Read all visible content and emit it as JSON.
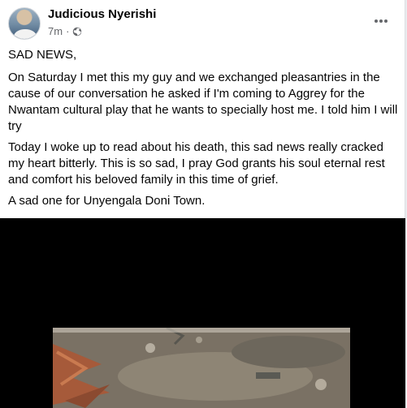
{
  "post": {
    "author": "Judicious Nyerishi",
    "time": "7m",
    "separator": "·",
    "paragraphs": [
      "SAD NEWS,",
      "On Saturday I met this my guy and we exchanged pleasantries in the cause of our conversation he asked if I'm coming to Aggrey for the Nwantam cultural play that he wants to specially host me. I told him I will try",
      "Today I woke up to read about his death, this sad news really cracked my heart bitterly. This is so sad, I pray God grants his soul eternal rest and comfort his beloved family in this time of grief.",
      "A sad one for Unyengala Doni Town."
    ]
  },
  "icons": {
    "audience": "globe-icon",
    "menu": "more-options-icon"
  },
  "colors": {
    "text_primary": "#050505",
    "text_secondary": "#65676b",
    "media_background": "#000000"
  }
}
